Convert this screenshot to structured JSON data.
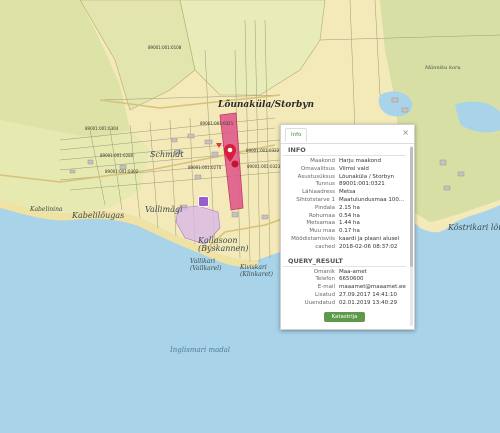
{
  "map": {
    "road_label": "Lõunaküla/Storbyn",
    "place_labels": {
      "schmidt": "Schmidt",
      "vallimagi": "Vallimägi",
      "kallasoon": "Kallasoon",
      "kallasoon_sub": "(Byskannen)",
      "vallikari": "Vallikari",
      "vallikari_sub": "(Vallkarel)",
      "kiviskari": "Kiviskari",
      "kiviskari_sub": "(Klinkaret)",
      "kabelilougas": "Kabelilõugas",
      "kabelinina": "Kabelinina",
      "kostrikari": "Köstrikari lõugas",
      "mannikukoru": "Männiku koru"
    },
    "water_labels": {
      "inglismaa": "Inglismari madal"
    },
    "parcel_ids": {
      "p1": "89001:001:0321",
      "p2": "89001:001:0322",
      "p3": "89001:001:0270",
      "p4": "89001:001:0323",
      "p5": "89001:001:0280",
      "p6": "89001:001:0108",
      "p7": "89001:001:0304",
      "p8": "89001:001:0302"
    },
    "colors": {
      "sea": "#a8d3e9",
      "land": "#f4e9b8",
      "forest": "#d9dea0",
      "highlight_parcel": "#e0558a",
      "marker": "#d81e3a",
      "badge": "#9b5dcc"
    }
  },
  "panel": {
    "tab_label": "Info",
    "close_label": "×",
    "info_heading": "INFO",
    "info_rows": [
      {
        "k": "Maakond",
        "v": "Harju maakond"
      },
      {
        "k": "Omavalitsus",
        "v": "Viimsi vald"
      },
      {
        "k": "Asustusüksus",
        "v": "Lõunaküla / Storbyn"
      },
      {
        "k": "Tunnus",
        "v": "89001:001:0321"
      },
      {
        "k": "Lähiaadress",
        "v": "Metsa"
      },
      {
        "k": "Sihtotstarve 1",
        "v": "Maatulundusmaa 100..."
      },
      {
        "k": "Pindala",
        "v": "2.15 ha"
      },
      {
        "k": "Rohumaa",
        "v": "0.54 ha"
      },
      {
        "k": "Metsamaa",
        "v": "1.44 ha"
      },
      {
        "k": "Muu maa",
        "v": "0.17 ha"
      },
      {
        "k": "Mõõdistamisviis",
        "v": "kaardi ja plaani alusel"
      },
      {
        "k": "cached",
        "v": "2018-02-06 08:37:02"
      }
    ],
    "query_heading": "QUERY_RESULT",
    "query_rows": [
      {
        "k": "Omanik",
        "v": "Maa-amet"
      },
      {
        "k": "Telefon",
        "v": "6650600"
      },
      {
        "k": "E-mail",
        "v": "maaamet@maaamet.ee"
      },
      {
        "k": "Lisatud",
        "v": "27.09.2017 14:41:10"
      },
      {
        "k": "Uuendatud",
        "v": "02.01.2019 13:40:29"
      }
    ],
    "button_label": "Katastrija"
  }
}
